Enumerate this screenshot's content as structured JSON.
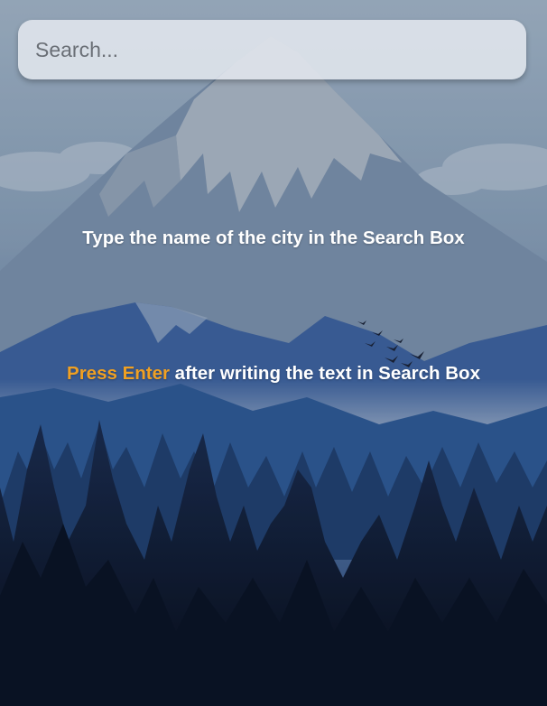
{
  "search": {
    "placeholder": "Search...",
    "value": ""
  },
  "messages": {
    "hint_1": "Type the name of the city in the Search Box",
    "hint_2_highlight": "Press Enter",
    "hint_2_rest": " after writing the text in Search Box"
  },
  "colors": {
    "highlight": "#f0a022",
    "text": "#ffffff",
    "sky_top": "#9fb3c6",
    "forest_bottom": "#0b1120"
  },
  "background": {
    "description_icon": "mountain-forest-landscape"
  }
}
